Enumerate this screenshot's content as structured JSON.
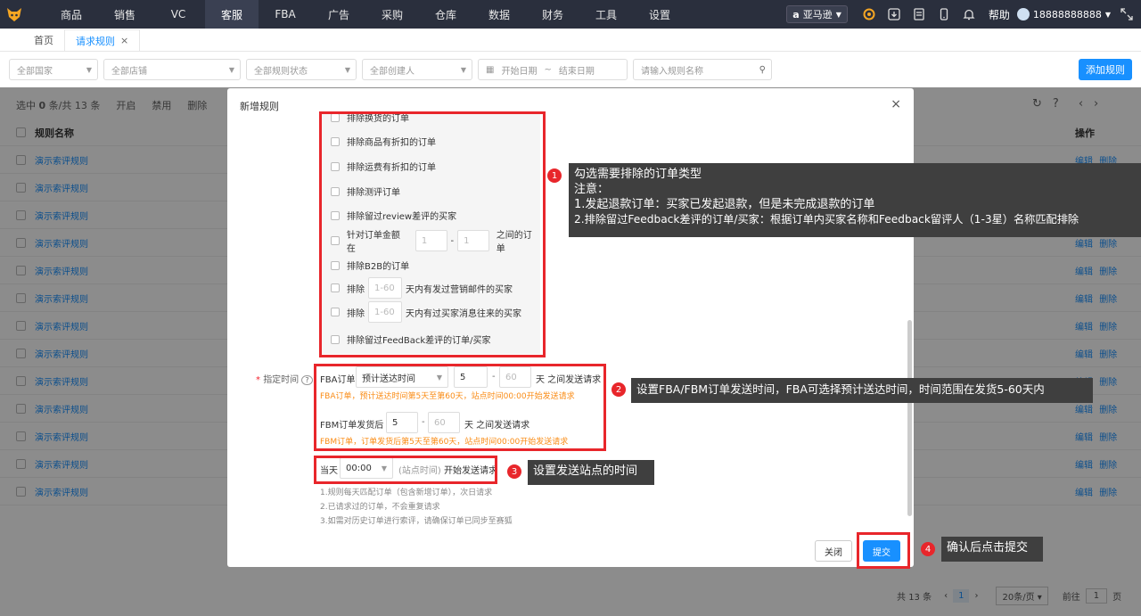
{
  "nav": {
    "items": [
      "商品",
      "销售",
      "VC",
      "客服",
      "FBA",
      "广告",
      "采购",
      "仓库",
      "数据",
      "财务",
      "工具",
      "设置"
    ],
    "active_index": 3,
    "marketplace": "亚马逊",
    "help": "帮助",
    "user": "18888888888"
  },
  "tabs": [
    "首页",
    "请求规则"
  ],
  "tab_close": "×",
  "filters": {
    "country": "全部国家",
    "store": "全部店铺",
    "rule_status": "全部规则状态",
    "creator": "全部创建人",
    "start_date": "开始日期",
    "date_sep": "~",
    "end_date": "结束日期",
    "search_placeholder": "请输入规则名称"
  },
  "add_rule": "添加规则",
  "toolbar": {
    "selected_prefix": "选中",
    "selected_count": "0",
    "selected_mid": "条/共",
    "total": "13",
    "selected_suffix": "条",
    "enable": "开启",
    "disable": "禁用",
    "delete": "删除"
  },
  "table": {
    "col_name": "规则名称",
    "col_ops": "操作",
    "rows": [
      "演示索评规则",
      "演示索评规则",
      "演示索评规则",
      "演示索评规则",
      "演示索评规则",
      "演示索评规则",
      "演示索评规则",
      "演示索评规则",
      "演示索评规则",
      "演示索评规则",
      "演示索评规则",
      "演示索评规则",
      "演示索评规则"
    ],
    "edit": "编辑",
    "delete": "删除"
  },
  "pager": {
    "total_prefix": "共",
    "total": "13",
    "total_suffix": "条",
    "current": "1",
    "page_size": "20条/页",
    "goto": "前往",
    "goto_val": "1",
    "goto_suffix": "页"
  },
  "modal": {
    "title": "新增规则",
    "close": "×",
    "exclude_items": {
      "top_partial": "排除换货的订单",
      "discount_item": "排除商品有折扣的订单",
      "discount_ship": "排除运费有折扣的订单",
      "test_orders": "排除测评订单",
      "review_buyer": "排除留过review差评的买家",
      "amount_prefix": "针对订单金额在",
      "amount_min": "1",
      "amount_max": "1",
      "amount_suffix": "之间的订单",
      "b2b": "排除B2B的订单",
      "mail_prefix": "排除",
      "mail_placeholder": "1-60",
      "mail_suffix": "天内有发过营销邮件的买家",
      "msg_prefix": "排除",
      "msg_placeholder": "1-60",
      "msg_suffix": "天内有过买家消息往来的买家",
      "feedback": "排除留过FeedBack差评的订单/买家"
    },
    "time_label": "指定时间",
    "required_mark": "*",
    "help_icon": "?",
    "fba_label": "FBA订单",
    "fba_select": "预计送达时间",
    "fba_from": "5",
    "fba_to": "60",
    "fba_unit": "天 之间发送请求",
    "fba_note": "FBA订单，预计送达时间第5天至第60天，站点时间00:00开始发送请求",
    "fbm_label": "FBM订单发货后",
    "fbm_from": "5",
    "fbm_to": "60",
    "fbm_unit": "天 之间发送请求",
    "fbm_note": "FBM订单，订单发货后第5天至第60天，站点时间00:00开始发送请求",
    "dash": "-",
    "day_label": "当天",
    "day_time": "00:00",
    "day_suffix_grey": "(站点时间)",
    "day_suffix": "开始发送请求",
    "notes": [
      "1.规则每天匹配订单（包含新增订单），次日请求",
      "2.已请求过的订单，不会重复请求",
      "3.如需对历史订单进行索评，请确保订单已同步至赛狐"
    ],
    "cancel": "关闭",
    "submit": "提交"
  },
  "callouts": {
    "c1": {
      "num": "1",
      "line1": "勾选需要排除的订单类型",
      "line2": "注意：",
      "line3": "1.发起退款订单：买家已发起退款，但是未完成退款的订单",
      "line4": "2.排除留过Feedback差评的订单/买家：根据订单内买家名称和Feedback留评人（1-3星）名称匹配排除"
    },
    "c2": {
      "num": "2",
      "text": "设置FBA/FBM订单发送时间，FBA可选择预计送达时间，时间范围在发货5-60天内"
    },
    "c3": {
      "num": "3",
      "text": "设置发送站点的时间"
    },
    "c4": {
      "num": "4",
      "text": "确认后点击提交"
    }
  },
  "colors": {
    "accent": "#1890ff",
    "nav_bg": "#2a2f3d",
    "annotation": "#e8262b",
    "warning": "#fa8c16"
  },
  "icons": [
    "logo-icon",
    "amazon-icon",
    "location-icon",
    "download-icon",
    "doc-icon",
    "phone-icon",
    "bell-icon",
    "expand-icon",
    "calendar-icon",
    "search-icon",
    "refresh-icon",
    "help-circle-icon",
    "chevron-left-icon",
    "chevron-right-icon",
    "close-icon",
    "chevron-down-icon"
  ]
}
